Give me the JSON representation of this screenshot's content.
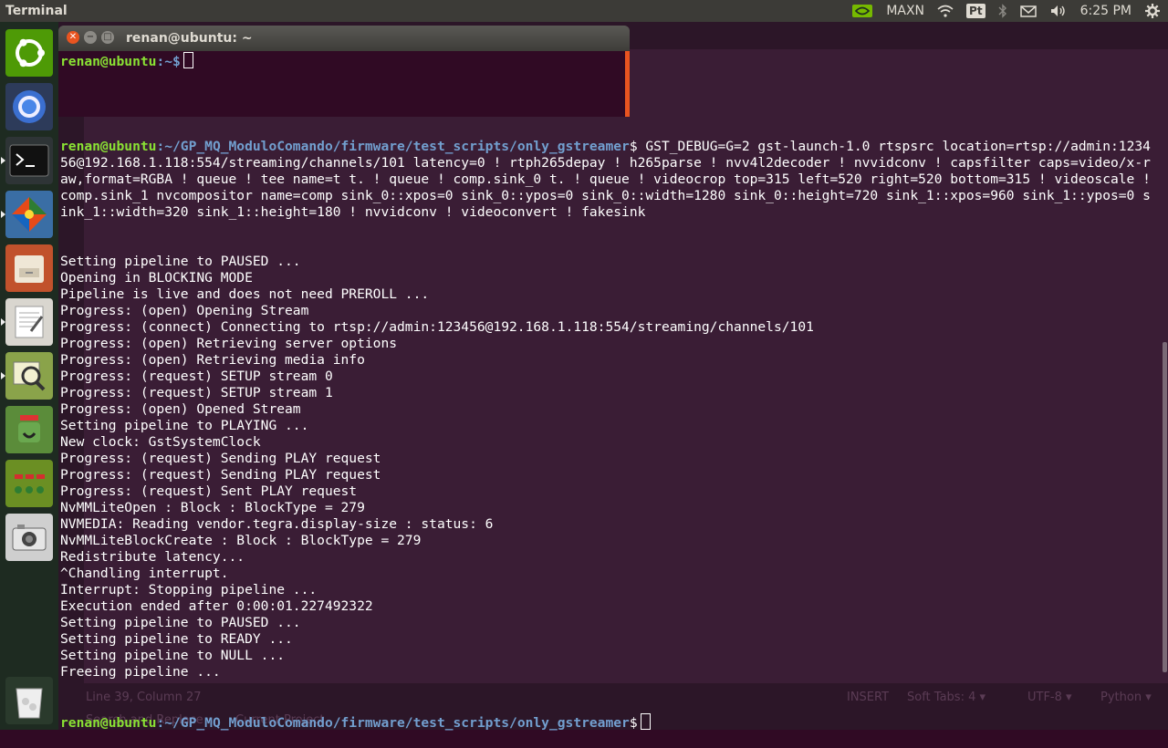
{
  "top_panel": {
    "app_title": "Terminal",
    "gpu_label": "MAXN",
    "pt_badge": "Pt",
    "clock": "6:25 PM",
    "icons": [
      "nvidia-icon",
      "wifi-icon",
      "bluetooth-icon",
      "mail-icon",
      "volume-icon",
      "gear-icon"
    ]
  },
  "launcher": {
    "items": [
      "ubuntu-dash",
      "chromium",
      "terminal",
      "git-gui",
      "files",
      "text-editor",
      "image-viewer",
      "pidgin",
      "app-grid",
      "camera",
      "trash"
    ]
  },
  "bg_editor": {
    "status_position": "Line 39, Column 27",
    "status_mode": "INSERT",
    "status_tabs": "Soft Tabs: 4 ▾",
    "status_encoding": "UTF-8 ▾",
    "status_lang": "Python ▾",
    "search_label": "Search and Replace",
    "project_label": "Current Project"
  },
  "small_terminal": {
    "title": "renan@ubuntu: ~",
    "prompt_user": "renan@ubuntu",
    "prompt_path": ":~$"
  },
  "terminal": {
    "prompt_user": "renan@ubuntu",
    "prompt_path": ":~/GP_MQ_ModuloComando/firmware/test_scripts/only_gstreamer",
    "command": "$ GST_DEBUG=G=2 gst-launch-1.0 rtspsrc location=rtsp://admin:123456@192.168.1.118:554/streaming/channels/101 latency=0 ! rtph265depay ! h265parse ! nvv4l2decoder ! nvvidconv ! capsfilter caps=video/x-raw,format=RGBA ! queue ! tee name=t t. ! queue ! comp.sink_0 t. ! queue ! videocrop top=315 left=520 right=520 bottom=315 ! videoscale ! comp.sink_1 nvcompositor name=comp sink_0::xpos=0 sink_0::ypos=0 sink_0::width=1280 sink_0::height=720 sink_1::xpos=960 sink_1::ypos=0 sink_1::width=320 sink_1::height=180 ! nvvidconv ! videoconvert ! fakesink",
    "output": [
      "Setting pipeline to PAUSED ...",
      "Opening in BLOCKING MODE",
      "Pipeline is live and does not need PREROLL ...",
      "Progress: (open) Opening Stream",
      "Progress: (connect) Connecting to rtsp://admin:123456@192.168.1.118:554/streaming/channels/101",
      "Progress: (open) Retrieving server options",
      "Progress: (open) Retrieving media info",
      "Progress: (request) SETUP stream 0",
      "Progress: (request) SETUP stream 1",
      "Progress: (open) Opened Stream",
      "Setting pipeline to PLAYING ...",
      "New clock: GstSystemClock",
      "Progress: (request) Sending PLAY request",
      "Progress: (request) Sending PLAY request",
      "Progress: (request) Sent PLAY request",
      "NvMMLiteOpen : Block : BlockType = 279",
      "NVMEDIA: Reading vendor.tegra.display-size : status: 6",
      "NvMMLiteBlockCreate : Block : BlockType = 279",
      "Redistribute latency...",
      "^Chandling interrupt.",
      "Interrupt: Stopping pipeline ...",
      "Execution ended after 0:00:01.227492322",
      "Setting pipeline to PAUSED ...",
      "Setting pipeline to READY ...",
      "Setting pipeline to NULL ...",
      "Freeing pipeline ..."
    ],
    "final_prompt_user": "renan@ubuntu",
    "final_prompt_path": ":~/GP_MQ_ModuloComando/firmware/test_scripts/only_gstreamer",
    "final_prompt_sign": "$"
  }
}
